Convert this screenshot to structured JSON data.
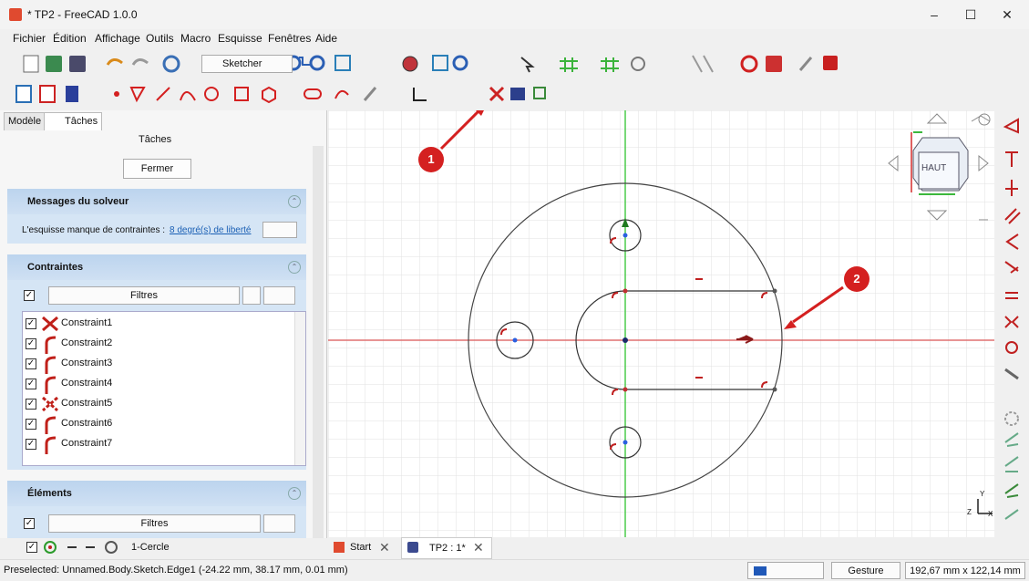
{
  "window": {
    "title": "* TP2 - FreeCAD 1.0.0",
    "minimize": "–",
    "maximize": "☐",
    "close": "✕"
  },
  "menus": [
    "Fichier",
    "Édition",
    "Affichage",
    "Outils",
    "Macro",
    "Esquisse",
    "Fenêtres",
    "Aide"
  ],
  "toolbar": {
    "workbench": "Sketcher"
  },
  "panel": {
    "tab_model": "Modèle",
    "tab_tasks": "Tâches",
    "header": "Tâches",
    "close_button": "Fermer",
    "solver": {
      "title": "Messages du solveur",
      "message": "L'esquisse manque de contraintes :",
      "link": "8 degré(s) de liberté"
    },
    "constraints": {
      "title": "Contraintes",
      "filter": "Filtres",
      "items": [
        "Constraint1",
        "Constraint2",
        "Constraint3",
        "Constraint4",
        "Constraint5",
        "Constraint6",
        "Constraint7"
      ]
    },
    "elements": {
      "title": "Éléments",
      "filter": "Filtres",
      "first_item": "1-Cercle"
    }
  },
  "view": {
    "navcube_label": "HAUT",
    "axis_x": "X",
    "axis_y": "Y",
    "axis_z": "Z",
    "callouts": [
      "1",
      "2"
    ],
    "colors": {
      "accent_red": "#d42020",
      "axis_green": "#3cb83c",
      "axis_red": "#e06060"
    }
  },
  "doc_tabs": [
    {
      "label": "Start",
      "close": "✕"
    },
    {
      "label": "TP2 : 1*",
      "close": "✕"
    }
  ],
  "status": {
    "text": "Preselected: Unnamed.Body.Sketch.Edge1 (-24.22 mm, 38.17 mm, 0.01 mm)",
    "navigation": "Gesture",
    "dimensions": "192,67 mm x 122,14 mm"
  }
}
